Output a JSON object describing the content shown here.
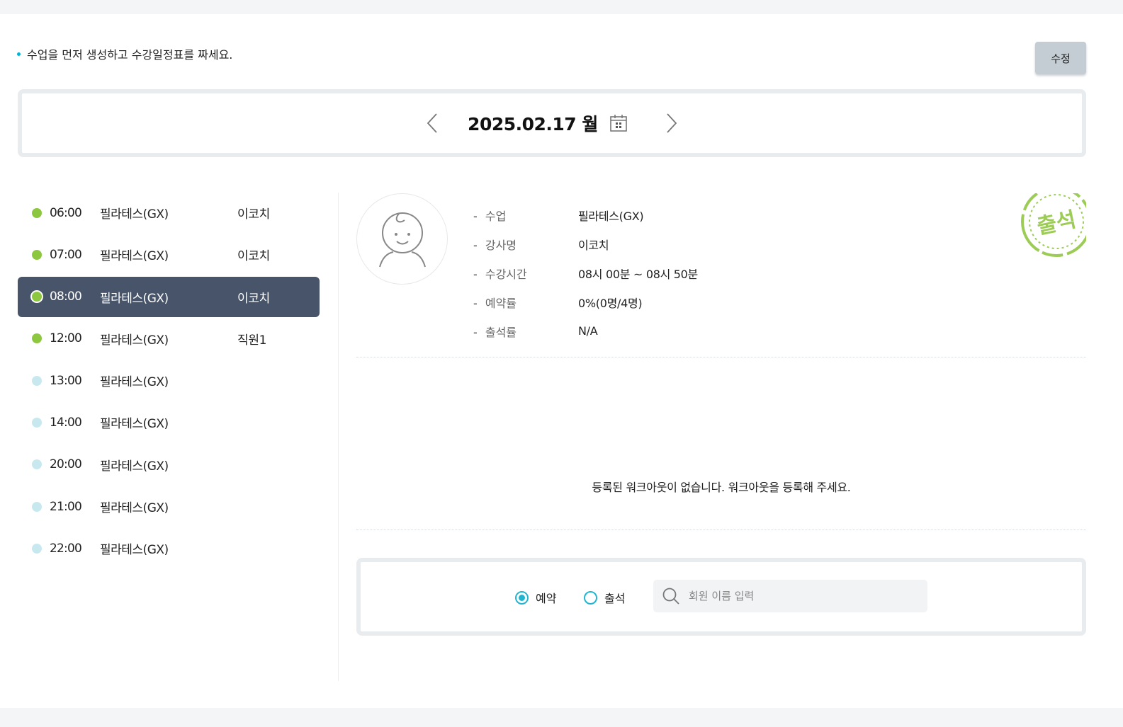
{
  "notice": {
    "text": "수업을 먼저 생성하고 수강일정표를 짜세요."
  },
  "toolbar": {
    "edit_label": "수정"
  },
  "date_nav": {
    "date": "2025.02.17",
    "weekday": "월"
  },
  "schedule": {
    "items": [
      {
        "time": "06:00",
        "class": "필라테스(GX)",
        "coach": "이코치",
        "status_color": "#8dc63f"
      },
      {
        "time": "07:00",
        "class": "필라테스(GX)",
        "coach": "이코치",
        "status_color": "#8dc63f"
      },
      {
        "time": "08:00",
        "class": "필라테스(GX)",
        "coach": "이코치",
        "status_color": "#8dc63f",
        "active": true
      },
      {
        "time": "12:00",
        "class": "필라테스(GX)",
        "coach": "직원1",
        "status_color": "#8dc63f"
      },
      {
        "time": "13:00",
        "class": "필라테스(GX)",
        "coach": "",
        "status_color": "#c8e8ef"
      },
      {
        "time": "14:00",
        "class": "필라테스(GX)",
        "coach": "",
        "status_color": "#c8e8ef"
      },
      {
        "time": "20:00",
        "class": "필라테스(GX)",
        "coach": "",
        "status_color": "#c8e8ef"
      },
      {
        "time": "21:00",
        "class": "필라테스(GX)",
        "coach": "",
        "status_color": "#c8e8ef"
      },
      {
        "time": "22:00",
        "class": "필라테스(GX)",
        "coach": "",
        "status_color": "#c8e8ef"
      }
    ]
  },
  "detail": {
    "rows": [
      {
        "label": "수업",
        "value": "필라테스(GX)"
      },
      {
        "label": "강사명",
        "value": "이코치"
      },
      {
        "label": "수강시간",
        "value": "08시 00분 ~ 08시 50분"
      },
      {
        "label": "예약률",
        "value": "0%(0명/4명)"
      },
      {
        "label": "출석률",
        "value": "N/A"
      }
    ],
    "stamp_text": "출석",
    "empty_message": "등록된 워크아웃이 없습니다. 워크아웃을 등록해 주세요."
  },
  "member_search": {
    "radio_reserve": "예약",
    "radio_attend": "출석",
    "selected": "reserve",
    "placeholder": "회원 이름 입력",
    "value": ""
  },
  "colors": {
    "active_row": "#485469",
    "accent": "#22b5cf",
    "stamp": "#9ccc55"
  }
}
